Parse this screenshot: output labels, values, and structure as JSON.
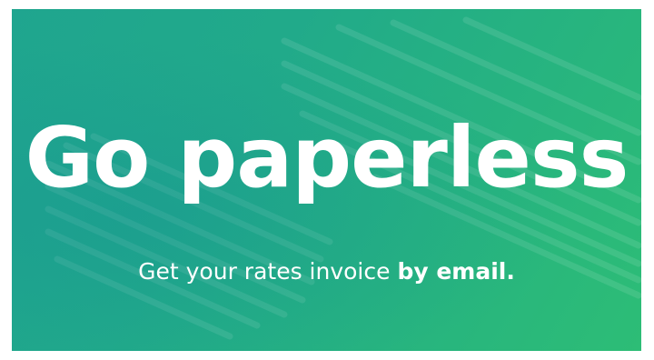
{
  "banner": {
    "headline": "Go paperless",
    "subline_regular": "Get your rates invoice ",
    "subline_bold": "by email.",
    "colors": {
      "gradient_start": "#1fa58f",
      "gradient_end": "#2dbd76",
      "text": "#ffffff"
    },
    "background_icon": "paper-stack-stripes-icon"
  }
}
